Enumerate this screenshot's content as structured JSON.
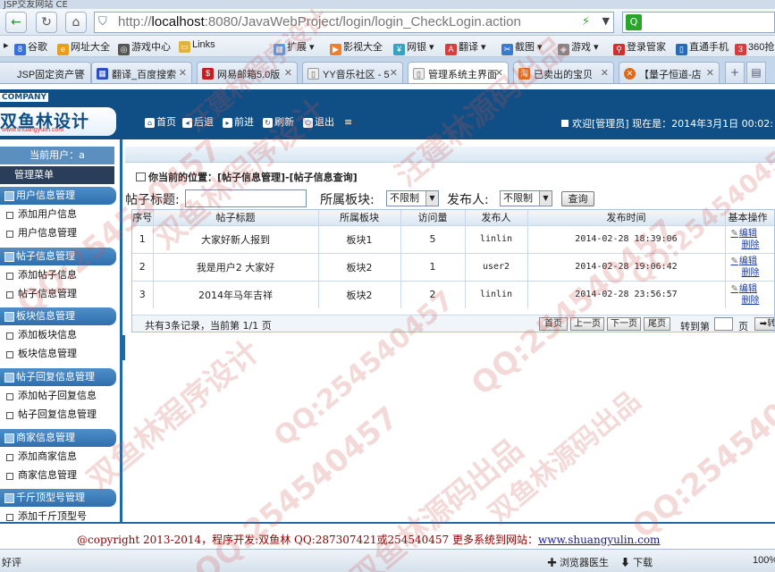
{
  "browser": {
    "window_title": "JSP交友网站 CE",
    "url_host": "localhost",
    "url_prefix": "http://",
    "url_rest": ":8080/JavaWebProject/login/login_CheckLogin.action",
    "favorites": [
      "谷歌",
      "网址大全",
      "游戏中心",
      "Links",
      "扩展",
      "影视大全",
      "网银",
      "翻译",
      "截图",
      "游戏",
      "登录管家",
      "直通手机",
      "360抢"
    ],
    "tabs": [
      "JSP固定资产管",
      "翻译_百度搜索",
      "网易邮箱5.0版",
      "YY音乐社区 - 5",
      "管理系统主界面",
      "已卖出的宝贝",
      "【量子恒道-店"
    ],
    "status_left": "好评",
    "status_items": [
      "浏览器医生",
      "下载",
      "100%"
    ]
  },
  "header": {
    "company": "COMPANY",
    "logo_text": "双鱼林设计",
    "logo_url": "www.shuangyulin.com",
    "buttons": [
      "首页",
      "后退",
      "前进",
      "刷新",
      "退出"
    ],
    "welcome": "欢迎[管理员]",
    "now_label": "现在是：2014年3月1日 00:02:"
  },
  "sidebar": {
    "current_user": "当前用户：a",
    "menu_title": "管理菜单",
    "groups": [
      {
        "title": "用户信息管理",
        "items": [
          "添加用户信息",
          "用户信息管理"
        ]
      },
      {
        "title": "帖子信息管理",
        "items": [
          "添加帖子信息",
          "帖子信息管理"
        ]
      },
      {
        "title": "板块信息管理",
        "items": [
          "添加板块信息",
          "板块信息管理"
        ]
      },
      {
        "title": "帖子回复信息管理",
        "items": [
          "添加帖子回复信息",
          "帖子回复信息管理"
        ]
      },
      {
        "title": "商家信息管理",
        "items": [
          "添加商家信息",
          "商家信息管理"
        ]
      },
      {
        "title": "千斤顶型号管理",
        "items": [
          "添加千斤顶型号"
        ]
      }
    ]
  },
  "main": {
    "location": "你当前的位置：[帖子信息管理]-[帖子信息查询]",
    "filters": {
      "title_label": "帖子标题:",
      "title_value": "",
      "board_label": "所属板块:",
      "board_value": "不限制",
      "publisher_label": "发布人:",
      "publisher_value": "不限制",
      "query_button": "查询"
    },
    "table": {
      "headers": [
        "序号",
        "帖子标题",
        "所属板块",
        "访问量",
        "发布人",
        "发布时间",
        "基本操作"
      ],
      "rows": [
        {
          "no": "1",
          "title": "大家好新人报到",
          "board": "板块1",
          "visits": "5",
          "user": "linlin",
          "time": "2014-02-28 18:39:06",
          "edit": "编辑",
          "del": "删除"
        },
        {
          "no": "2",
          "title": "我是用户2 大家好",
          "board": "板块2",
          "visits": "1",
          "user": "user2",
          "time": "2014-02-28 19:06:42",
          "edit": "编辑",
          "del": "删除"
        },
        {
          "no": "3",
          "title": "2014年马年吉祥",
          "board": "板块2",
          "visits": "2",
          "user": "linlin",
          "time": "2014-02-28 23:56:57",
          "edit": "编辑",
          "del": "删除"
        }
      ]
    },
    "pager": {
      "info": "共有3条记录，当前第 1/1 页",
      "first": "首页",
      "prev": "上一页",
      "next": "下一页",
      "last": "尾页",
      "goto_label": "转到第",
      "goto_value": "",
      "page_unit": "页",
      "go": "转"
    }
  },
  "footer": {
    "text": "@copyright 2013-2014，程序开发:双鱼林  QQ:287307421或254540457  更多系统到网站：",
    "link": "www.shuangyulin.com"
  },
  "watermarks": [
    "双鱼林程序设计",
    "QQ:254540457",
    "汪建林源码出品",
    "QQ:254540457",
    "双鱼林程序设计",
    "QQ:254540457",
    "双鱼林源码出品",
    "QQ:254540457",
    "汪建林程序设计",
    "QQ:254540457",
    "双鱼林源码出品",
    "QQ:254540457"
  ],
  "colors": {
    "header_bg": "#0f4f85",
    "menu_group": "#2f6fae",
    "footer_text": "#8b0000",
    "watermark": "#cd5050"
  }
}
